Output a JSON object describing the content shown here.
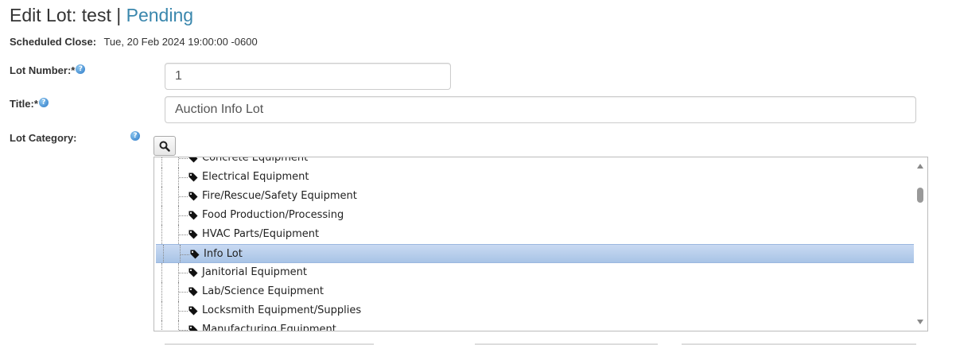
{
  "header": {
    "prefix": "Edit Lot: ",
    "lot_name": "test",
    "separator": " | ",
    "status": "Pending",
    "status_color": "#3a87ad"
  },
  "schedule": {
    "label": "Scheduled Close:",
    "value": "Tue, 20 Feb 2024 19:00:00 -0600"
  },
  "form": {
    "lot_number": {
      "label": "Lot Number:*",
      "value": "1",
      "help_icon": "question-circle-icon"
    },
    "title": {
      "label": "Title:*",
      "value": "Auction Info Lot",
      "help_icon": "question-circle-icon"
    },
    "category": {
      "label": "Lot Category:",
      "help_icon": "question-circle-icon",
      "search_icon": "magnifier-icon",
      "selected": "Info Lot",
      "items": [
        "Concrete Equipment",
        "Electrical Equipment",
        "Fire/Rescue/Safety Equipment",
        "Food Production/Processing",
        "HVAC Parts/Equipment",
        "Info Lot",
        "Janitorial Equipment",
        "Lab/Science Equipment",
        "Locksmith Equipment/Supplies",
        "Manufacturing Equipment"
      ]
    }
  }
}
